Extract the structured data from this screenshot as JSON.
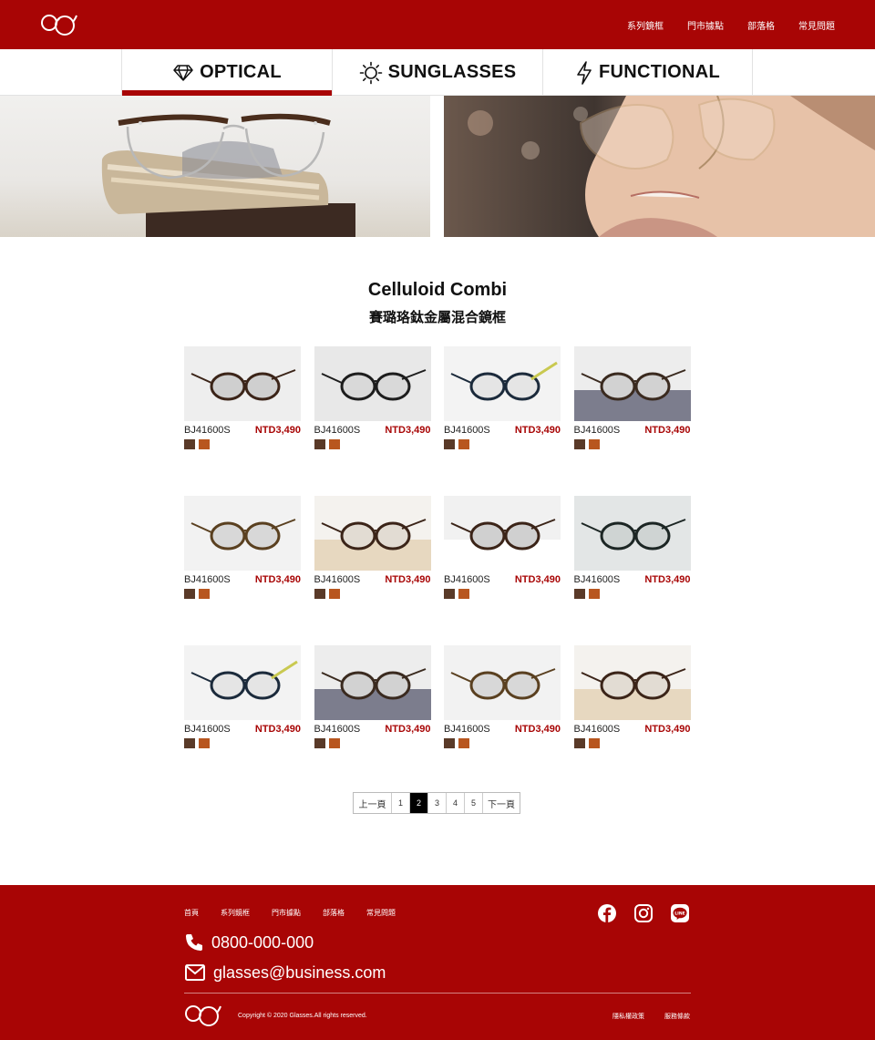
{
  "header": {
    "nav": [
      "系列鏡框",
      "門市據點",
      "部落格",
      "常見問題"
    ]
  },
  "tabs": [
    {
      "label": "OPTICAL",
      "icon": "diamond-icon",
      "active": true
    },
    {
      "label": "SUNGLASSES",
      "icon": "sun-icon",
      "active": false
    },
    {
      "label": "FUNCTIONAL",
      "icon": "lightning-icon",
      "active": false
    }
  ],
  "section": {
    "title_en": "Celluloid Combi",
    "title_zh": "賽璐珞鈦金屬混合鏡框"
  },
  "products": [
    {
      "sku": "BJ41600S",
      "price": "NTD3,490"
    },
    {
      "sku": "BJ41600S",
      "price": "NTD3,490"
    },
    {
      "sku": "BJ41600S",
      "price": "NTD3,490"
    },
    {
      "sku": "BJ41600S",
      "price": "NTD3,490"
    },
    {
      "sku": "BJ41600S",
      "price": "NTD3,490"
    },
    {
      "sku": "BJ41600S",
      "price": "NTD3,490"
    },
    {
      "sku": "BJ41600S",
      "price": "NTD3,490"
    },
    {
      "sku": "BJ41600S",
      "price": "NTD3,490"
    },
    {
      "sku": "BJ41600S",
      "price": "NTD3,490"
    },
    {
      "sku": "BJ41600S",
      "price": "NTD3,490"
    },
    {
      "sku": "BJ41600S",
      "price": "NTD3,490"
    },
    {
      "sku": "BJ41600S",
      "price": "NTD3,490"
    }
  ],
  "swatch_colors": [
    "#5a3a28",
    "#b8561f"
  ],
  "pagination": {
    "prev": "上一頁",
    "next": "下一頁",
    "pages": [
      "1",
      "2",
      "3",
      "4",
      "5"
    ],
    "current": "2"
  },
  "footer": {
    "nav": [
      "首頁",
      "系列鏡框",
      "門市據點",
      "部落格",
      "常見問題"
    ],
    "phone": "0800-000-000",
    "email": "glasses@business.com",
    "copyright": "Copyright © 2020 Glasses.All rights reserved.",
    "links": [
      "隱私權政策",
      "服務條款"
    ],
    "social": [
      "facebook-icon",
      "instagram-icon",
      "line-icon"
    ]
  },
  "colors": {
    "brand": "#a80505",
    "price": "#a80505"
  }
}
